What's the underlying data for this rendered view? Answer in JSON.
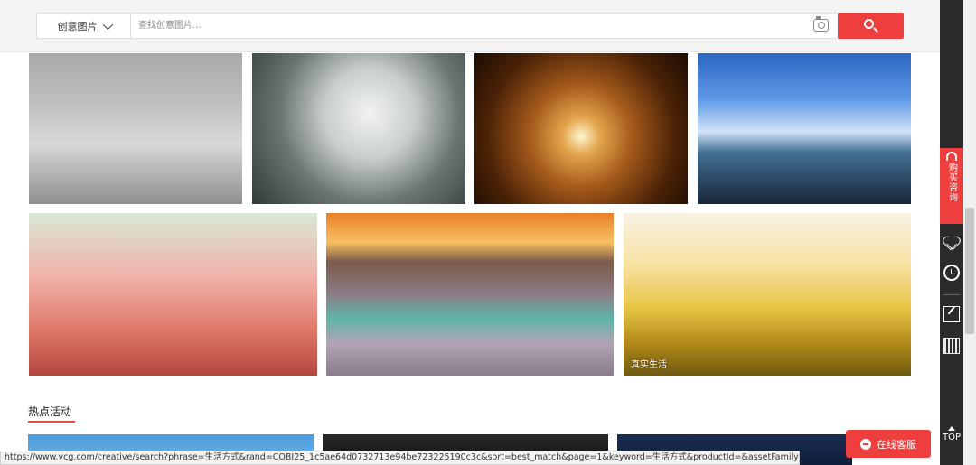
{
  "search": {
    "category": "创意图片",
    "placeholder": "查找创意图片..."
  },
  "photos": [
    {
      "label": ""
    },
    {
      "label": ""
    },
    {
      "label": ""
    },
    {
      "label": ""
    },
    {
      "label": ""
    },
    {
      "label": ""
    },
    {
      "label": "真实生活"
    }
  ],
  "section": {
    "title": "热点活动"
  },
  "status_url": "https://www.vcg.com/creative/search?phrase=生活方式&rand=COBI25_1c5ae64d0732713e94be723225190c3c&sort=best_match&page=1&keyword=生活方式&productId=&assetFamily=2",
  "online_service": {
    "label": "在线客服"
  },
  "sidebar": {
    "consult_label": "购买咨询",
    "top_label": "TOP"
  },
  "colors": {
    "accent": "#ef3e3e",
    "sidebar": "#2b2b2b"
  }
}
